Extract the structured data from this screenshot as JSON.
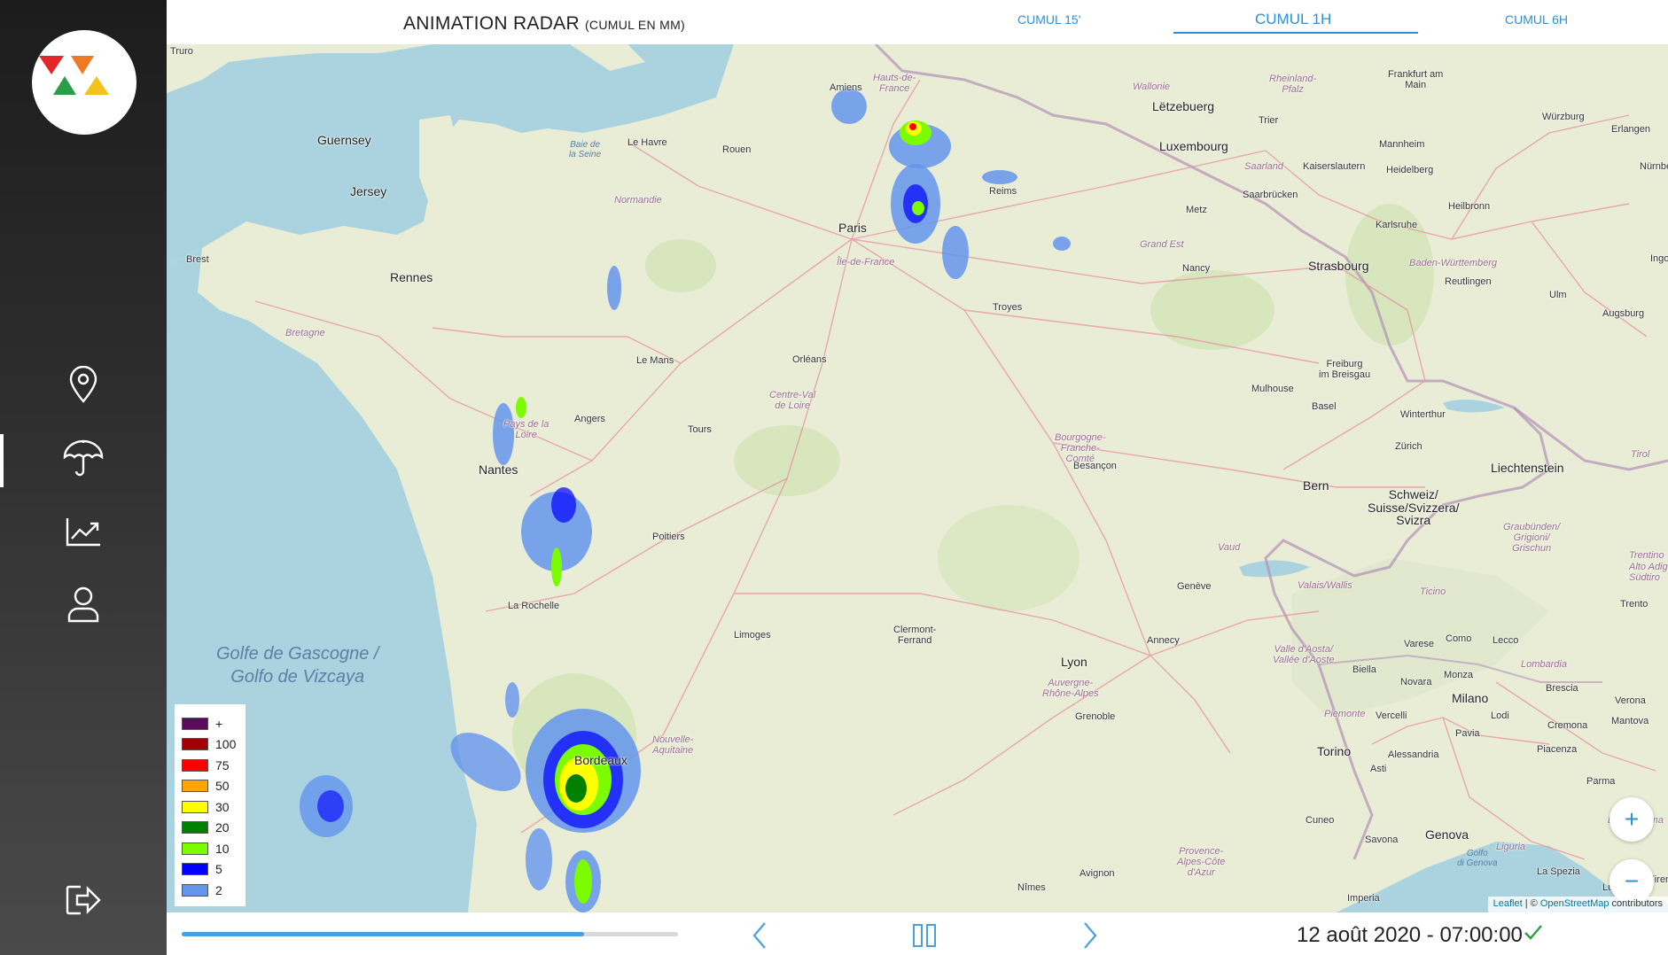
{
  "header": {
    "title": "ANIMATION RADAR",
    "title_unit": "(CUMUL EN MM)",
    "tabs": [
      {
        "label": "CUMUL 15'",
        "active": false
      },
      {
        "label": "CUMUL 1H",
        "active": true
      },
      {
        "label": "CUMUL 6H",
        "active": false
      }
    ]
  },
  "sidebar": {
    "items": [
      {
        "icon": "location-pin-icon",
        "active": false
      },
      {
        "icon": "umbrella-icon",
        "active": true
      },
      {
        "icon": "trend-chart-icon",
        "active": false
      },
      {
        "icon": "user-icon",
        "active": false
      }
    ],
    "logout_icon": "logout-icon"
  },
  "map": {
    "places": {
      "truro": "Truro",
      "guernsey": "Guernsey",
      "jersey": "Jersey",
      "brest": "Brest",
      "rennes": "Rennes",
      "nantes": "Nantes",
      "la_rochelle": "La Rochelle",
      "bordeaux": "Bordeaux",
      "le_havre": "Le Havre",
      "rouen": "Rouen",
      "amiens": "Amiens",
      "paris": "Paris",
      "reims": "Reims",
      "le_mans": "Le Mans",
      "angers": "Angers",
      "tours": "Tours",
      "orleans": "Orléans",
      "poitiers": "Poitiers",
      "limoges": "Limoges",
      "clermont": "Clermont-\nFerrand",
      "lyon": "Lyon",
      "grenoble": "Grenoble",
      "annecy": "Annecy",
      "geneve": "Genève",
      "besancon": "Besançon",
      "troyes": "Troyes",
      "nancy": "Nancy",
      "metz": "Metz",
      "strasbourg": "Strasbourg",
      "mulhouse": "Mulhouse",
      "bale": "Basel",
      "zurich": "Zürich",
      "winterthur": "Winterthur",
      "bern": "Bern",
      "luxembourg": "Luxembourg",
      "letzebuerg": "Lëtzebuerg",
      "trier": "Trier",
      "saarbrucken": "Saarbrücken",
      "kaiserslautern": "Kaiserslautern",
      "mannheim": "Mannheim",
      "heidelberg": "Heidelberg",
      "heilbronn": "Heilbronn",
      "karlsruhe": "Karlsruhe",
      "frankfurt": "Frankfurt am\nMain",
      "wurzburg": "Würzburg",
      "erlangen": "Erlangen",
      "nurnberg": "Nürnberg",
      "reutlingen": "Reutlingen",
      "ulm": "Ulm",
      "augsburg": "Augsburg",
      "freiburg": "Freiburg\nim Breisgau",
      "liechtenstein": "Liechtenstein",
      "schweiz": "Schweiz/\nSuisse/Svizzera/\nSvizra",
      "milano": "Milano",
      "torino": "Torino",
      "genova": "Genova",
      "cuneo": "Cuneo",
      "asti": "Asti",
      "alessandria": "Alessandria",
      "novara": "Novara",
      "biella": "Biella",
      "vercelli": "Vercelli",
      "monza": "Monza",
      "como": "Como",
      "varese": "Varese",
      "lecco": "Lecco",
      "brescia": "Brescia",
      "verona": "Verona",
      "mantova": "Mantova",
      "cremona": "Cremona",
      "lodi": "Lodi",
      "pavia": "Pavia",
      "piacenza": "Piacenza",
      "parma": "Parma",
      "savona": "Savona",
      "la_spezia": "La Spezia",
      "lucca": "Lucca",
      "imperia": "Imperia",
      "nimes": "Nîmes",
      "avignon": "Avignon",
      "trento": "Trento",
      "wallonie": "Wallonie",
      "rheinland": "Rheinland-\nPfalz",
      "saarland": "Saarland",
      "baden": "Baden-Württemberg",
      "grand_est": "Grand Est",
      "bretagne": "Bretagne",
      "normandie": "Normandie",
      "ile_de_france": "Île-de-France",
      "hauts_de_france": "Hauts-de-\nFrance",
      "pays_de_la_loire": "Pays de la\nLoire",
      "centre": "Centre-Val\nde Loire",
      "bourgogne": "Bourgogne-\nFranche-\nComté",
      "nouvelle_aquitaine": "Nouvelle-\nAquitaine",
      "auvergne": "Auvergne-\nRhône-Alpes",
      "provence": "Provence-\nAlpes-Côte\nd'Azur",
      "vaud": "Vaud",
      "valais": "Valais/Wallis",
      "ticino": "Ticino",
      "graubunden": "Graubünden/\nGrigioni/\nGrischun",
      "aosta": "Valle d'Aosta/\nVallée d'Aoste",
      "piemonte": "Piemonte",
      "lombardia": "Lombardia",
      "liguria": "Liguria",
      "emilia": "Emilia-Roma",
      "baie_de_seine": "Baie de\nla Seine",
      "golfo_genova": "Golfo\ndi Genova",
      "golfe": "Golfe de Gascogne /\nGolfo de Vizcaya",
      "tirol": "Tirol",
      "ingo": "Ingo",
      "trentino": "Trentino\nAlto Adig\nSüdtiro",
      "firenze": "Firenz"
    },
    "attribution": {
      "leaflet": "Leaflet",
      "separator": " | © ",
      "osm": "OpenStreetMap",
      "suffix": " contributors"
    },
    "zoom_in": "+",
    "zoom_out": "−"
  },
  "legend": {
    "items": [
      {
        "label": "+",
        "color": "#5c0a5c"
      },
      {
        "label": "100",
        "color": "#a00000"
      },
      {
        "label": "75",
        "color": "#ff0000"
      },
      {
        "label": "50",
        "color": "#ffa500"
      },
      {
        "label": "30",
        "color": "#ffff00"
      },
      {
        "label": "20",
        "color": "#008000"
      },
      {
        "label": "10",
        "color": "#7cfc00"
      },
      {
        "label": "5",
        "color": "#0000ff"
      },
      {
        "label": "2",
        "color": "#6495ed"
      }
    ]
  },
  "player": {
    "progress": 0.81,
    "timestamp": "12 août 2020 - 07:00:00",
    "status": "check-icon"
  },
  "colors": {
    "accent": "#2e8fd6",
    "sea": "#aad3df",
    "land": "#e9edd6"
  }
}
